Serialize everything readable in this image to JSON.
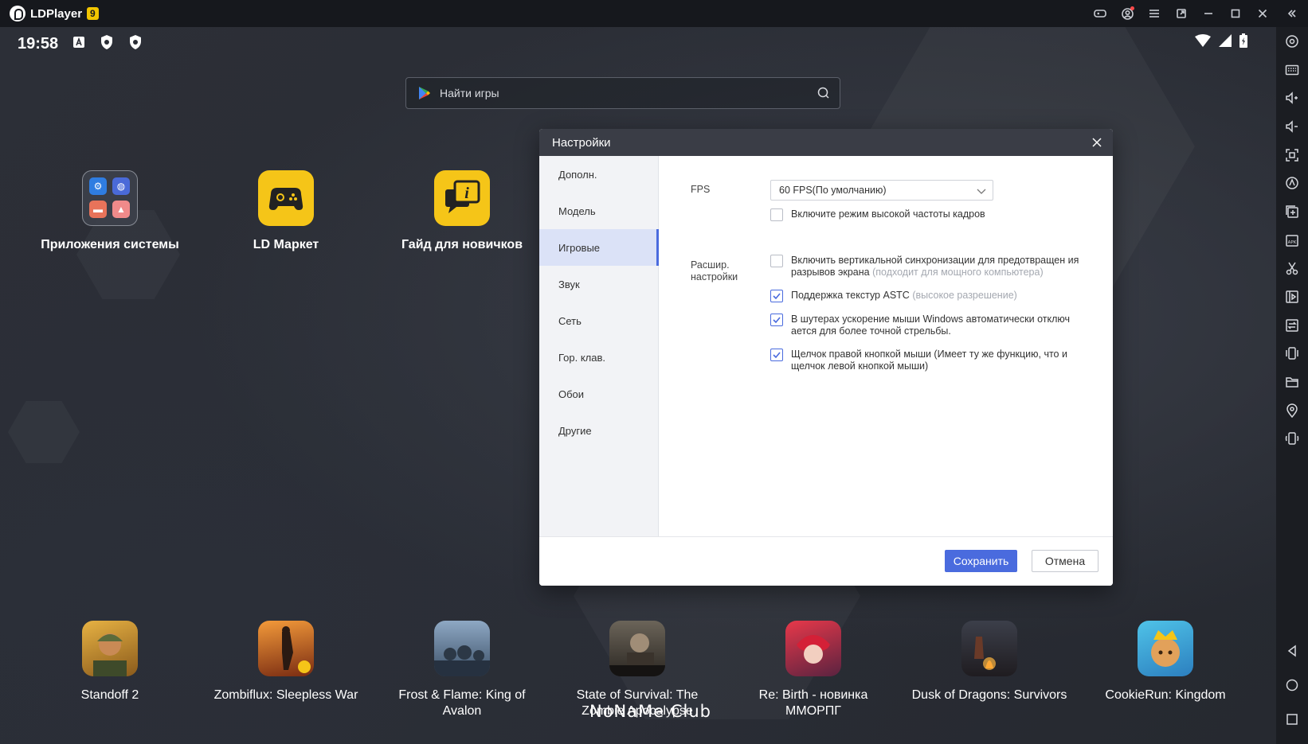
{
  "titlebar": {
    "app_name": "LDPlayer",
    "version_badge": "9",
    "icons": [
      "gamepad-icon",
      "account-icon",
      "menu-icon",
      "window-mode-icon",
      "minimize-icon",
      "maximize-icon",
      "close-icon",
      "collapse-toolbar-icon"
    ]
  },
  "statusbar": {
    "time": "19:58"
  },
  "search": {
    "placeholder": "Найти игры"
  },
  "desktop_apps": [
    {
      "label": "Приложения системы",
      "icon": "system-apps-folder-icon"
    },
    {
      "label": "LD Маркет",
      "icon": "ld-market-icon"
    },
    {
      "label": "Гайд для новичков",
      "icon": "beginner-guide-icon"
    }
  ],
  "dock_games": [
    {
      "label": "Standoff 2"
    },
    {
      "label": "Zombiflux: Sleepless War"
    },
    {
      "label": "Frost & Flame: King of Avalon"
    },
    {
      "label": "State of Survival: The Zombie Apocalypse"
    },
    {
      "label": "Re: Birth - новинка ММОРПГ"
    },
    {
      "label": "Dusk of Dragons: Survivors"
    },
    {
      "label": "CookieRun: Kingdom"
    }
  ],
  "watermark": "NoNaMe Club",
  "dialog": {
    "title": "Настройки",
    "nav": [
      "Дополн.",
      "Модель",
      "Игровые",
      "Звук",
      "Сеть",
      "Гор. клав.",
      "Обои",
      "Другие"
    ],
    "active_nav": "Игровые",
    "fps_label": "FPS",
    "fps_value": "60 FPS(По умолчанию)",
    "high_fps_label": "Включите режим высокой частоты кадров",
    "high_fps_checked": false,
    "advanced_label_1": "Расшир.",
    "advanced_label_2": "настройки",
    "vsync_text": "Включить вертикальной синхронизации для предотвращен ия разрывов экрана",
    "vsync_hint": "(подходит для мощного компьютера)",
    "vsync_checked": false,
    "astc_text": "Поддержка текстур ASTC",
    "astc_hint": "(высокое разрешение)",
    "astc_checked": true,
    "mouse_accel_text": "В шутерах ускорение мыши Windows автоматически отключ ается для более точной стрельбы.",
    "mouse_accel_checked": true,
    "right_click_text": "Щелчок правой кнопкой мыши (Имеет ту же функцию, что и щелчок левой кнопкой мыши)",
    "right_click_checked": true,
    "save_label": "Сохранить",
    "cancel_label": "Отмена"
  },
  "colors": {
    "accent": "#4a6bde",
    "titlebar_bg": "#16181d",
    "dialog_header": "#3a3d46",
    "badge": "#f2c500"
  }
}
